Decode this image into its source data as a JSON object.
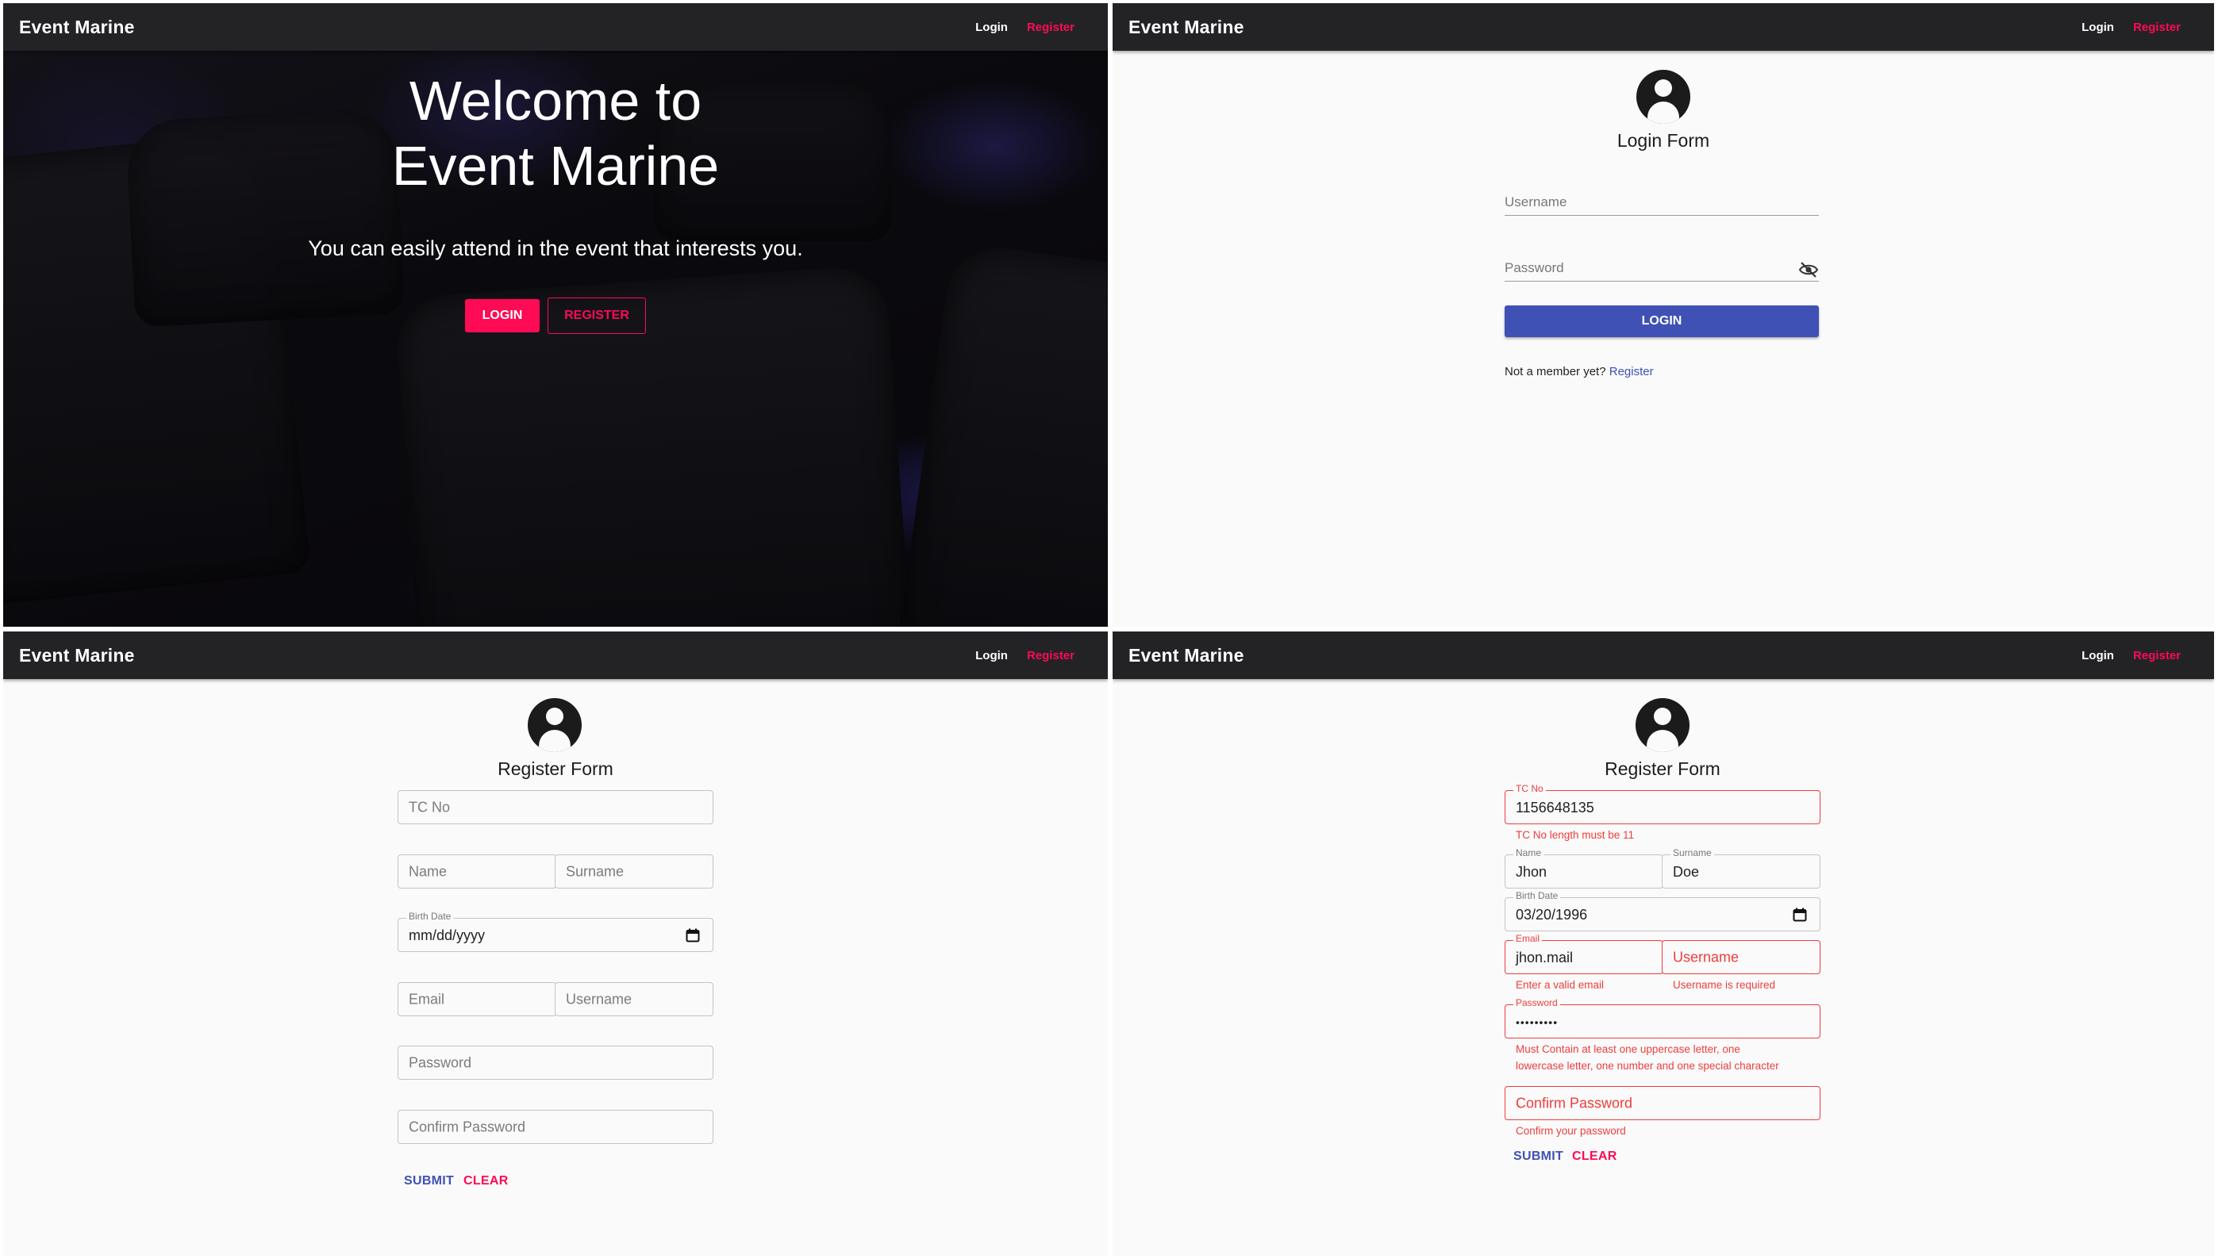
{
  "appbar": {
    "brand": "Event Marine",
    "login": "Login",
    "register": "Register"
  },
  "home": {
    "title_line1": "Welcome to",
    "title_line2": "Event Marine",
    "subtitle": "You can easily attend in the event that interests you.",
    "login_button": "LOGIN",
    "register_button": "REGISTER"
  },
  "login": {
    "title": "Login Form",
    "username_label": "Username",
    "password_label": "Password",
    "login_button": "LOGIN",
    "member_text": "Not a member yet?",
    "register_link": "Register",
    "icons": [
      "account-circle-icon",
      "visibility-off-icon"
    ]
  },
  "register_empty": {
    "title": "Register Form",
    "tc_placeholder": "TC No",
    "name_placeholder": "Name",
    "surname_placeholder": "Surname",
    "birth_label": "Birth Date",
    "birth_value": "mm/dd/yyyy",
    "email_placeholder": "Email",
    "username_placeholder": "Username",
    "password_placeholder": "Password",
    "confirm_placeholder": "Confirm Password",
    "submit": "SUBMIT",
    "clear": "CLEAR"
  },
  "register_filled": {
    "title": "Register Form",
    "tc_label": "TC No",
    "tc_value": "1156648135",
    "tc_error": "TC No length must be 11",
    "name_label": "Name",
    "name_value": "Jhon",
    "surname_label": "Surname",
    "surname_value": "Doe",
    "birth_label": "Birth Date",
    "birth_value": "03/20/1996",
    "email_label": "Email",
    "email_value": "jhon.mail",
    "email_error": "Enter a valid email",
    "username_placeholder": "Username",
    "username_error": "Username is required",
    "password_label": "Password",
    "password_value": "•••••••••",
    "password_error_line1": "Must Contain at least one uppercase letter, one",
    "password_error_line2": "lowercase letter, one number and one special character",
    "confirm_placeholder": "Confirm Password",
    "confirm_error": "Confirm your password",
    "submit": "SUBMIT",
    "clear": "CLEAR"
  },
  "colors": {
    "appbar": "#232326",
    "accent_pink": "#ff0a55",
    "primary_blue": "#3f51b5",
    "error_red": "#ef3d3d"
  }
}
